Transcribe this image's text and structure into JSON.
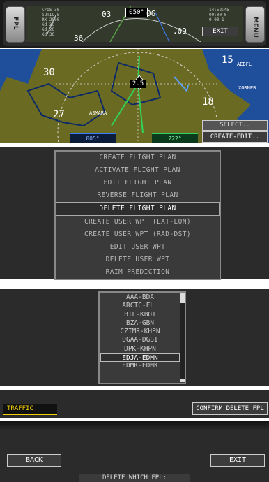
{
  "top_bar": {
    "knob_left": "FPL",
    "knob_right": "MENU",
    "left_data": [
      "C/OS 30",
      "SUTIO 8",
      "RX 2000",
      "Gd 20",
      "Gd 20",
      "Gd 30"
    ],
    "heading": "050°",
    "compass": {
      "c03": "03",
      "c06": "06",
      "c09": ".09",
      "c36": "36"
    },
    "right_data": [
      "14:52:45",
      "00:00 0",
      "0:00 1"
    ],
    "exit_label": "EXIT"
  },
  "map": {
    "compass": {
      "c30": "30",
      "c27": "27",
      "c15": "15",
      "c18": "18"
    },
    "ownship_alt": "2.5",
    "labels": [
      "ASMARA",
      "AEBFL",
      "XORNEB"
    ],
    "left_readout": "005°",
    "right_readout": "222°",
    "softkeys": [
      "SELECT..",
      "CREATE-EDIT.."
    ]
  },
  "menu": {
    "items": [
      {
        "label": "CREATE FLIGHT PLAN",
        "selected": false
      },
      {
        "label": "ACTIVATE FLIGHT PLAN",
        "selected": false
      },
      {
        "label": "EDIT FLIGHT PLAN",
        "selected": false
      },
      {
        "label": "REVERSE FLIGHT PLAN",
        "selected": false
      },
      {
        "label": "DELETE FLIGHT PLAN",
        "selected": true
      },
      {
        "label": "CREATE USER WPT (LAT-LON)",
        "selected": false
      },
      {
        "label": "CREATE USER WPT (RAD-DST)",
        "selected": false
      },
      {
        "label": "EDIT USER WPT",
        "selected": false
      },
      {
        "label": "DELETE USER WPT",
        "selected": false
      },
      {
        "label": "RAIM PREDICTION",
        "selected": false
      }
    ]
  },
  "fpl_list": {
    "items": [
      {
        "label": "AAA-BDA",
        "selected": false
      },
      {
        "label": "ARCTC-FLL",
        "selected": false
      },
      {
        "label": "BIL-KBOI",
        "selected": false
      },
      {
        "label": "BZA-GBN",
        "selected": false
      },
      {
        "label": "CZIMR-KHPN",
        "selected": false
      },
      {
        "label": "DGAA-DGSI",
        "selected": false
      },
      {
        "label": "DPK-KHPN",
        "selected": false
      },
      {
        "label": "EDJA-EDMN",
        "selected": true
      },
      {
        "label": "EDMK-EDMK",
        "selected": false
      }
    ],
    "scroll_fraction": 0.0
  },
  "bottom_bar": {
    "traffic_label": "TRAFFIC",
    "confirm_label": "CONFIRM DELETE FPL"
  },
  "bottom_panel": {
    "back_label": "BACK",
    "exit_label": "EXIT",
    "prompt": "DELETE WHICH FPL:"
  },
  "colors": {
    "map_terrain": "#6b6a22",
    "route_green": "#2fd35a",
    "traffic_yellow": "#f5d000",
    "dark_bg": "#2b2b2b"
  }
}
